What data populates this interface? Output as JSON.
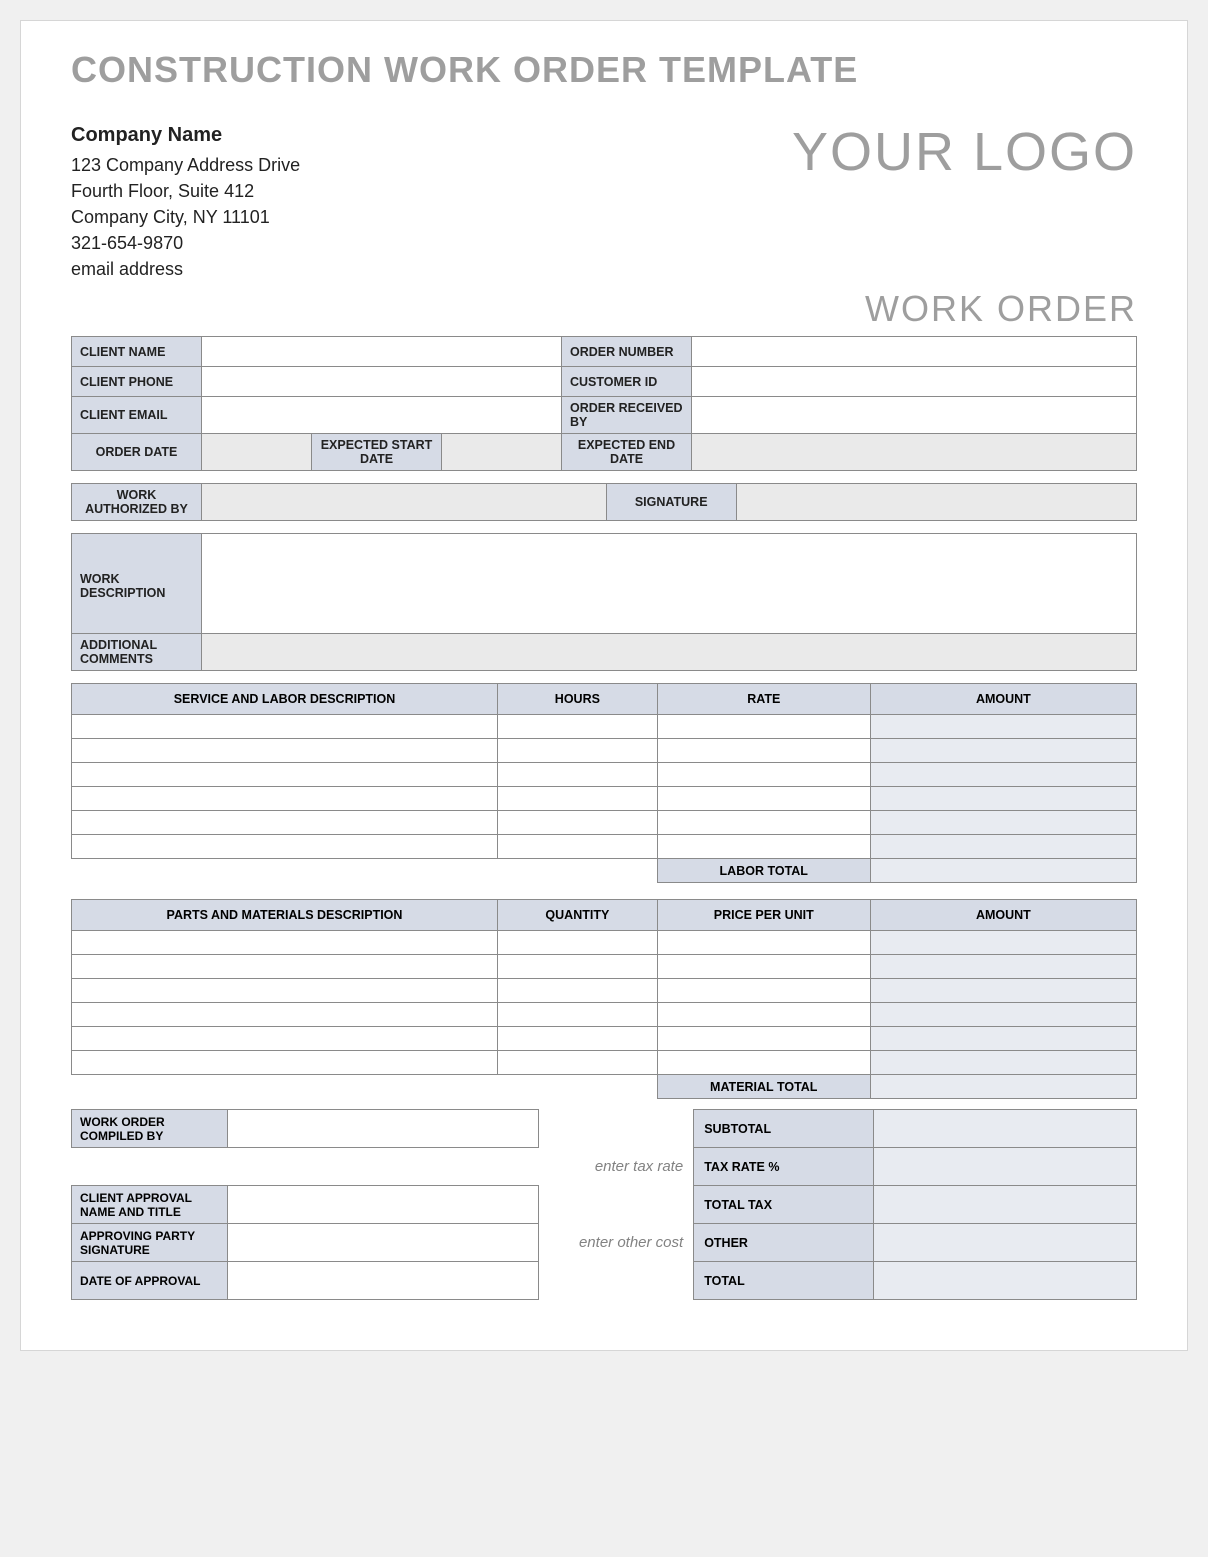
{
  "title": "CONSTRUCTION WORK ORDER TEMPLATE",
  "company": {
    "name": "Company Name",
    "addr1": "123 Company Address Drive",
    "addr2": "Fourth Floor, Suite 412",
    "city": "Company City, NY  11101",
    "phone": "321-654-9870",
    "email": "email address"
  },
  "logo_text": "YOUR LOGO",
  "subtitle": "WORK ORDER",
  "info": {
    "client_name_label": "CLIENT NAME",
    "client_name": "",
    "order_number_label": "ORDER NUMBER",
    "order_number": "",
    "client_phone_label": "CLIENT PHONE",
    "client_phone": "",
    "customer_id_label": "CUSTOMER ID",
    "customer_id": "",
    "client_email_label": "CLIENT EMAIL",
    "client_email": "",
    "order_received_by_label": "ORDER RECEIVED BY",
    "order_received_by": "",
    "order_date_label": "ORDER DATE",
    "order_date": "",
    "expected_start_label": "EXPECTED START DATE",
    "expected_start": "",
    "expected_end_label": "EXPECTED END DATE",
    "expected_end": ""
  },
  "auth": {
    "authorized_by_label": "WORK AUTHORIZED BY",
    "authorized_by": "",
    "signature_label": "SIGNATURE",
    "signature": ""
  },
  "desc": {
    "work_desc_label": "WORK DESCRIPTION",
    "work_desc": "",
    "additional_comments_label": "ADDITIONAL COMMENTS",
    "additional_comments": ""
  },
  "labor": {
    "headers": {
      "desc": "SERVICE AND LABOR DESCRIPTION",
      "hours": "HOURS",
      "rate": "RATE",
      "amount": "AMOUNT"
    },
    "rows": [
      {
        "desc": "",
        "hours": "",
        "rate": "",
        "amount": ""
      },
      {
        "desc": "",
        "hours": "",
        "rate": "",
        "amount": ""
      },
      {
        "desc": "",
        "hours": "",
        "rate": "",
        "amount": ""
      },
      {
        "desc": "",
        "hours": "",
        "rate": "",
        "amount": ""
      },
      {
        "desc": "",
        "hours": "",
        "rate": "",
        "amount": ""
      },
      {
        "desc": "",
        "hours": "",
        "rate": "",
        "amount": ""
      }
    ],
    "total_label": "LABOR TOTAL",
    "total": ""
  },
  "materials": {
    "headers": {
      "desc": "PARTS AND MATERIALS DESCRIPTION",
      "qty": "QUANTITY",
      "price": "PRICE PER UNIT",
      "amount": "AMOUNT"
    },
    "rows": [
      {
        "desc": "",
        "qty": "",
        "price": "",
        "amount": ""
      },
      {
        "desc": "",
        "qty": "",
        "price": "",
        "amount": ""
      },
      {
        "desc": "",
        "qty": "",
        "price": "",
        "amount": ""
      },
      {
        "desc": "",
        "qty": "",
        "price": "",
        "amount": ""
      },
      {
        "desc": "",
        "qty": "",
        "price": "",
        "amount": ""
      },
      {
        "desc": "",
        "qty": "",
        "price": "",
        "amount": ""
      }
    ],
    "total_label": "MATERIAL TOTAL",
    "total": ""
  },
  "footer": {
    "compiled_by_label": "WORK ORDER COMPILED BY",
    "compiled_by": "",
    "client_approval_label": "CLIENT APPROVAL NAME AND TITLE",
    "client_approval": "",
    "approving_sig_label": "APPROVING PARTY SIGNATURE",
    "approving_sig": "",
    "date_approval_label": "DATE OF APPROVAL",
    "date_approval": "",
    "tax_hint": "enter tax rate",
    "other_hint": "enter other cost"
  },
  "summary": {
    "subtotal_label": "SUBTOTAL",
    "subtotal": "",
    "tax_rate_label": "TAX RATE %",
    "tax_rate": "",
    "total_tax_label": "TOTAL TAX",
    "total_tax": "",
    "other_label": "OTHER",
    "other": "",
    "total_label": "TOTAL",
    "total": ""
  }
}
